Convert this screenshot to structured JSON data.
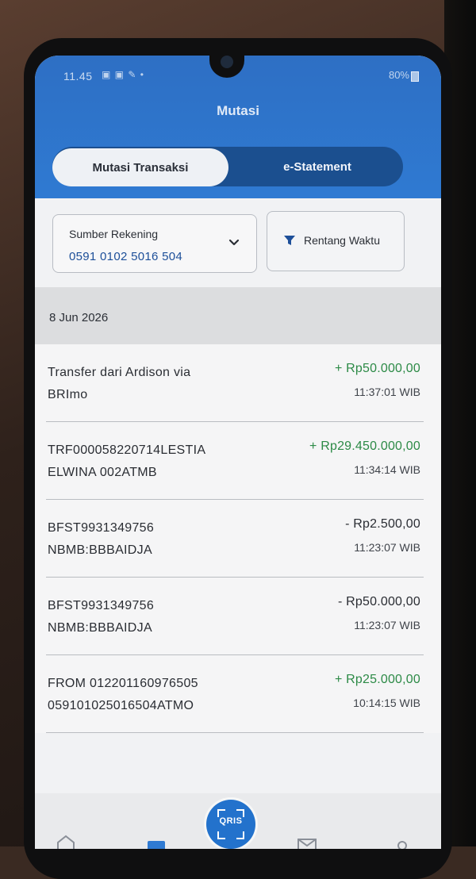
{
  "status_bar": {
    "time": "11.45",
    "battery": "80%"
  },
  "header": {
    "title": "Mutasi",
    "tabs": [
      {
        "label": "Mutasi Transaksi",
        "active": true
      },
      {
        "label": "e-Statement",
        "active": false
      }
    ]
  },
  "filters": {
    "account_label": "Sumber Rekening",
    "account_number": "0591 0102 5016 504",
    "date_range_label": "Rentang Waktu"
  },
  "date_header": "8 Jun 2026",
  "transactions": [
    {
      "line1": "Transfer dari Ardison via",
      "line2": "BRImo",
      "amount": "+ Rp50.000,00",
      "time": "11:37:01 WIB",
      "type": "credit"
    },
    {
      "line1": "TRF000058220714LESTIA",
      "line2": "ELWINA 002ATMB",
      "amount": "+ Rp29.450.000,00",
      "time": "11:34:14 WIB",
      "type": "credit"
    },
    {
      "line1": "BFST9931349756",
      "line2": "NBMB:BBBAIDJA",
      "amount": "- Rp2.500,00",
      "time": "11:23:07 WIB",
      "type": "debit"
    },
    {
      "line1": "BFST9931349756",
      "line2": "NBMB:BBBAIDJA",
      "amount": "- Rp50.000,00",
      "time": "11:23:07 WIB",
      "type": "debit"
    },
    {
      "line1": "FROM 012201160976505",
      "line2": "059101025016504ATMO",
      "amount": "+ Rp25.000,00",
      "time": "10:14:15 WIB",
      "type": "credit"
    }
  ],
  "bottom_nav": {
    "qris_label": "QRIS"
  },
  "colors": {
    "header_blue": "#2f7ad2",
    "segment_dark": "#1b4f8f",
    "credit_green": "#2c8a46",
    "account_blue": "#1d4f99"
  }
}
